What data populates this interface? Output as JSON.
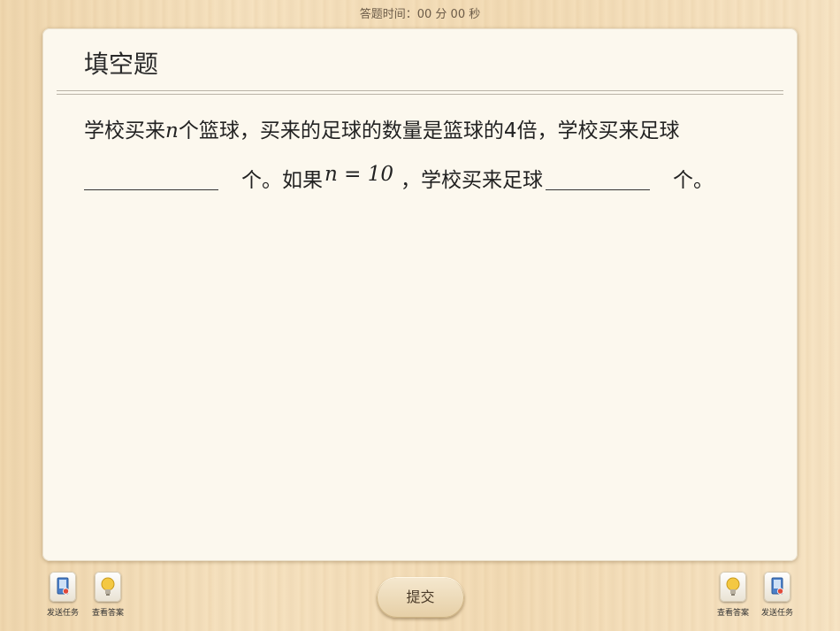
{
  "timer": "答题时间：00 分 00 秒",
  "question": {
    "type_title": "填空题",
    "line1": {
      "before": "学校买来",
      "var": "n",
      "after": "个篮球，买来的足球的数量是篮球的4倍，学校买来足球"
    },
    "line2": {
      "unit1": "个。如果",
      "math": "n = 10",
      "middle": "，学校买来足球",
      "unit2": "个。"
    }
  },
  "toolbar": {
    "left": [
      {
        "label": "发送任务",
        "icon": "send-task-icon"
      },
      {
        "label": "查看答案",
        "icon": "lightbulb-icon"
      }
    ],
    "submit": "提交",
    "right": [
      {
        "label": "查看答案",
        "icon": "lightbulb-icon"
      },
      {
        "label": "发送任务",
        "icon": "send-task-icon"
      }
    ]
  },
  "colors": {
    "card_bg": "#fcf8ee",
    "wood_bg": "#f3dcb6",
    "text": "#222222",
    "send_icon_blue": "#4a7fc8",
    "bulb_yellow": "#f4c842"
  }
}
